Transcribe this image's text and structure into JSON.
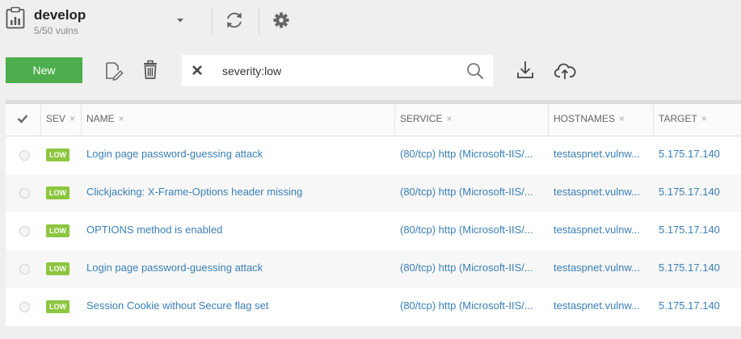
{
  "workspace": {
    "name": "develop",
    "subtitle": "5/50 vulns"
  },
  "toolbar": {
    "new_label": "New"
  },
  "search": {
    "value": "severity:low",
    "placeholder": ""
  },
  "columns": [
    {
      "label": "SEV",
      "close": "×"
    },
    {
      "label": "NAME",
      "close": "×"
    },
    {
      "label": "SERVICE",
      "close": "×"
    },
    {
      "label": "HOSTNAMES",
      "close": "×"
    },
    {
      "label": "TARGET",
      "close": "×"
    }
  ],
  "rows": [
    {
      "sev": "LOW",
      "name": "Login page password-guessing attack",
      "service": "(80/tcp) http (Microsoft-IIS/...",
      "hostnames": "testaspnet.vulnw...",
      "target": "5.175.17.140"
    },
    {
      "sev": "LOW",
      "name": "Clickjacking: X-Frame-Options header missing",
      "service": "(80/tcp) http (Microsoft-IIS/...",
      "hostnames": "testaspnet.vulnw...",
      "target": "5.175.17.140"
    },
    {
      "sev": "LOW",
      "name": "OPTIONS method is enabled",
      "service": "(80/tcp) http (Microsoft-IIS/...",
      "hostnames": "testaspnet.vulnw...",
      "target": "5.175.17.140"
    },
    {
      "sev": "LOW",
      "name": "Login page password-guessing attack",
      "service": "(80/tcp) http (Microsoft-IIS/...",
      "hostnames": "testaspnet.vulnw...",
      "target": "5.175.17.140"
    },
    {
      "sev": "LOW",
      "name": "Session Cookie without Secure flag set",
      "service": "(80/tcp) http (Microsoft-IIS/...",
      "hostnames": "testaspnet.vulnw...",
      "target": "5.175.17.140"
    }
  ],
  "colors": {
    "accent": "#4cae4c",
    "link": "#3a7fb5",
    "badge_low": "#8cc63f"
  }
}
